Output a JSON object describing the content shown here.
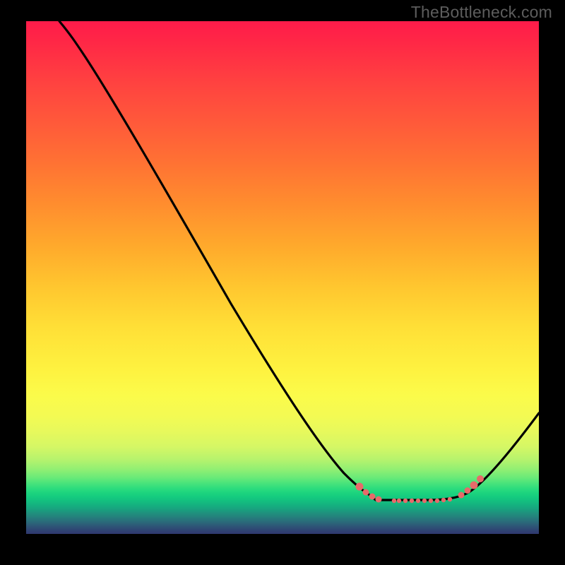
{
  "watermark": "TheBottleneck.com",
  "chart_data": {
    "type": "line",
    "title": "",
    "xlabel": "",
    "ylabel": "",
    "xlim": [
      0,
      100
    ],
    "ylim": [
      0,
      100
    ],
    "background": {
      "kind": "vertical-gradient",
      "semantic": "bottleneck-severity-heatmap",
      "stops": [
        {
          "pos": 0,
          "color": "#ff1b4a"
        },
        {
          "pos": 50,
          "color": "#ffc72f"
        },
        {
          "pos": 75,
          "color": "#f3fa53"
        },
        {
          "pos": 90,
          "color": "#2bdc7d"
        },
        {
          "pos": 100,
          "color": "#2f386f"
        }
      ]
    },
    "series": [
      {
        "name": "bottleneck-curve",
        "color": "#000000",
        "x": [
          6,
          11,
          17,
          26,
          40,
          48,
          57,
          62,
          66,
          68,
          78,
          86,
          90,
          100
        ],
        "y": [
          100,
          94,
          86,
          70,
          45,
          31,
          18,
          12,
          9,
          7,
          7,
          8,
          12,
          24
        ]
      },
      {
        "name": "optimal-range-markers",
        "color": "#e76a6a",
        "style": "scatter",
        "x": [
          65,
          66,
          67,
          69,
          72,
          73,
          74,
          75,
          76,
          77,
          79,
          80,
          81,
          83,
          85,
          86,
          87,
          89
        ],
        "y": [
          9,
          8,
          7.4,
          6.8,
          6.5,
          6.5,
          6.5,
          6.5,
          6.5,
          6.5,
          6.5,
          6.5,
          6.6,
          6.8,
          7.6,
          8.5,
          9.5,
          10.7
        ]
      }
    ]
  }
}
